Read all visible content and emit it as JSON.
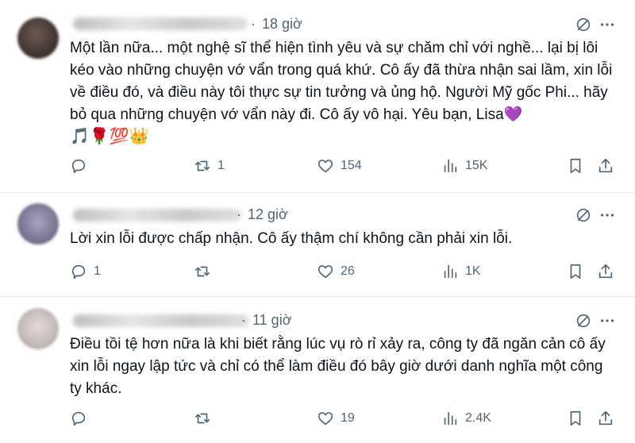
{
  "tweets": [
    {
      "time": "18 giờ",
      "text": "Một lần nữa... một nghệ sĩ thể hiện tình yêu và sự chăm chỉ với nghề... lại bị lôi kéo vào những chuyện vớ vẩn trong quá khứ. Cô ấy đã thừa nhận sai lầm, xin lỗi về điều đó, và điều này tôi thực sự tin tưởng và ủng hộ. Người Mỹ gốc Phi... hãy bỏ qua những chuyện vớ vẩn này đi. Cô ấy vô hại. Yêu bạn, Lisa💜",
      "emojis": "🎵🌹💯👑",
      "replies": "",
      "reposts": "1",
      "likes": "154",
      "views": "15K"
    },
    {
      "time": "12 giờ",
      "text": "Lời xin lỗi được chấp nhận. Cô ấy thậm chí không cần phải xin lỗi.",
      "emojis": "",
      "replies": "1",
      "reposts": "",
      "likes": "26",
      "views": "1K"
    },
    {
      "time": "11 giờ",
      "text": "Điều tồi tệ hơn nữa là khi biết rằng lúc vụ rò rỉ xảy ra, công ty đã ngăn cản cô ấy xin lỗi ngay lập tức và chỉ có thể làm điều đó bây giờ dưới danh nghĩa một công ty khác.",
      "emojis": "",
      "replies": "",
      "reposts": "",
      "likes": "19",
      "views": "2.4K"
    }
  ],
  "time_separator": "·",
  "icons": {
    "reply": "reply-icon",
    "repost": "repost-icon",
    "like": "like-icon",
    "views": "views-icon",
    "bookmark": "bookmark-icon",
    "share": "share-icon",
    "grok": "grok-icon",
    "more": "more-icon"
  },
  "colors": {
    "text": "#0f1419",
    "muted": "#536471",
    "divider": "#e6e9ec"
  }
}
